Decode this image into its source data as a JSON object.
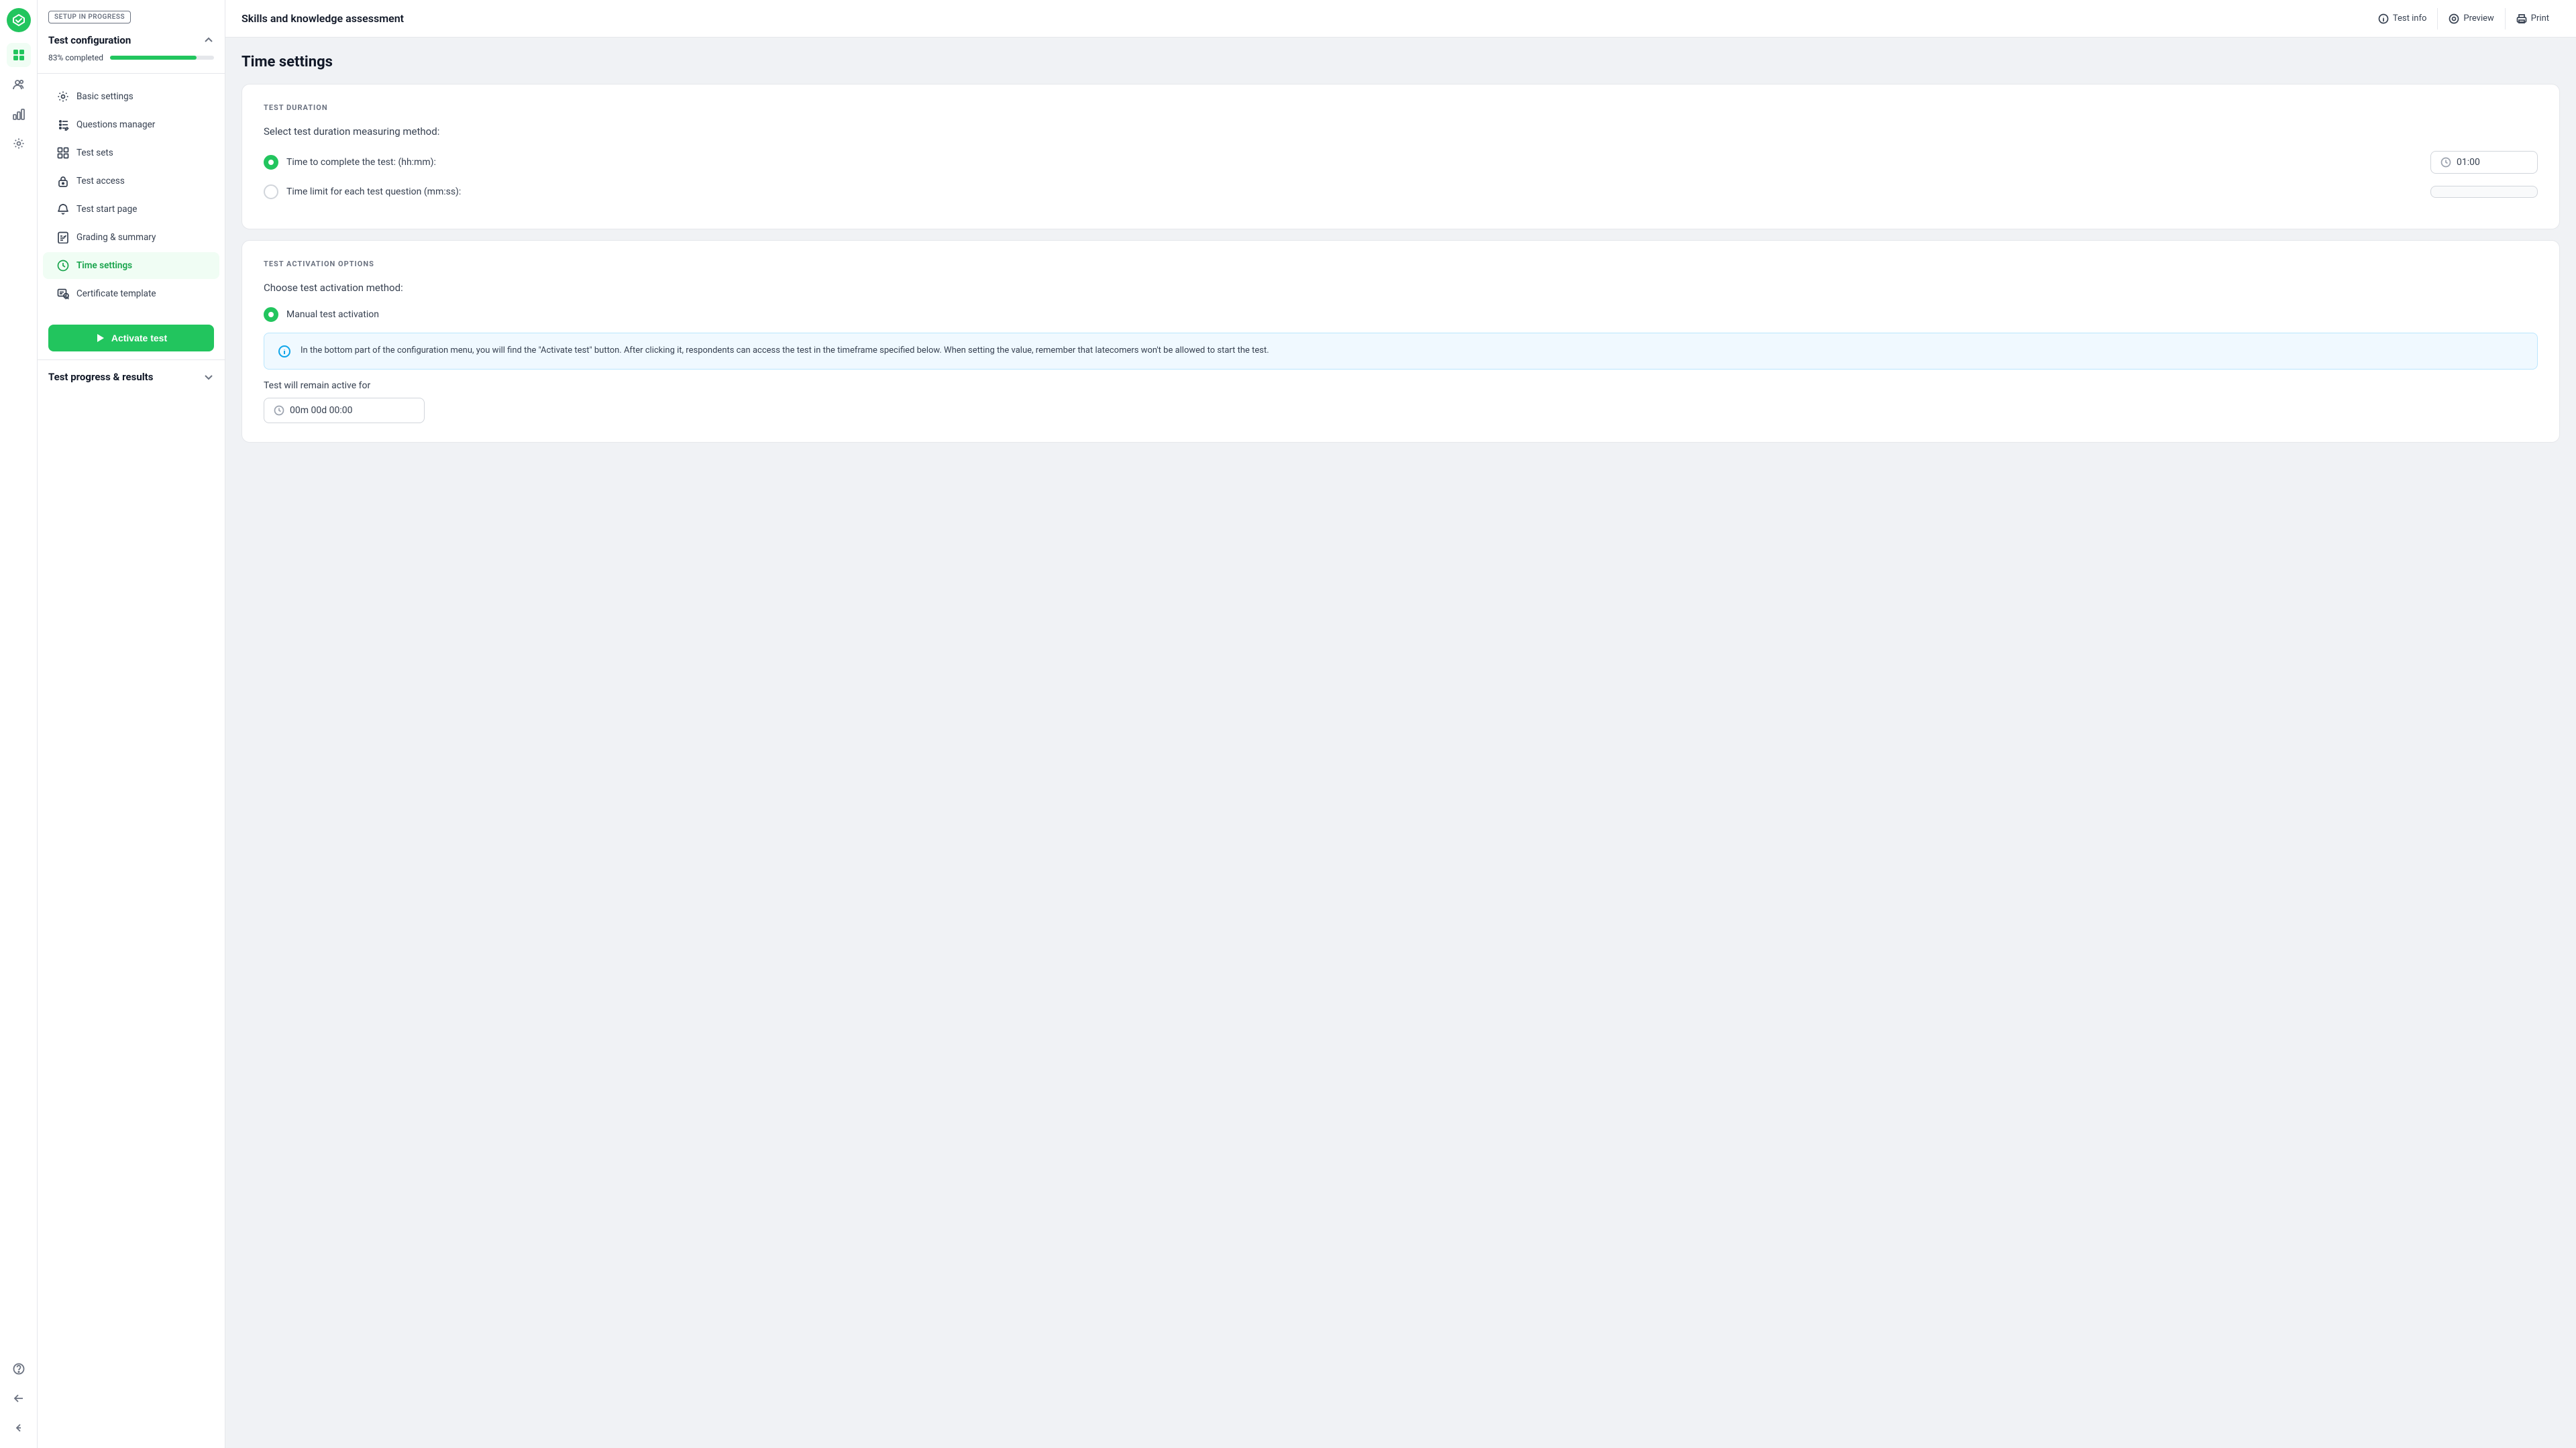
{
  "app": {
    "title": "Skills and knowledge assessment"
  },
  "topbar": {
    "test_info_label": "Test info",
    "preview_label": "Preview",
    "print_label": "Print"
  },
  "sidebar": {
    "setup_badge": "SETUP IN PROGRESS",
    "configuration_title": "Test configuration",
    "progress_label": "83% completed",
    "progress_percent": 83,
    "nav_items": [
      {
        "id": "basic-settings",
        "label": "Basic settings",
        "icon": "gear"
      },
      {
        "id": "questions-manager",
        "label": "Questions manager",
        "icon": "list-edit"
      },
      {
        "id": "test-sets",
        "label": "Test sets",
        "icon": "grid"
      },
      {
        "id": "test-access",
        "label": "Test access",
        "icon": "lock"
      },
      {
        "id": "test-start-page",
        "label": "Test start page",
        "icon": "bell"
      },
      {
        "id": "grading-summary",
        "label": "Grading & summary",
        "icon": "doc-chart"
      },
      {
        "id": "time-settings",
        "label": "Time settings",
        "icon": "clock",
        "active": true
      },
      {
        "id": "certificate-template",
        "label": "Certificate template",
        "icon": "certificate"
      }
    ],
    "activate_btn": "Activate test",
    "progress_results_title": "Test progress & results"
  },
  "main": {
    "page_title": "Time settings",
    "sections": {
      "duration": {
        "label": "TEST DURATION",
        "description": "Select test duration measuring method:",
        "options": [
          {
            "id": "complete-test",
            "label": "Time to complete the test: (hh:mm):",
            "checked": true,
            "value": "01:00"
          },
          {
            "id": "per-question",
            "label": "Time limit for each test question (mm:ss):",
            "checked": false,
            "value": ""
          }
        ]
      },
      "activation": {
        "label": "TEST ACTIVATION OPTIONS",
        "description": "Choose test activation method:",
        "options": [
          {
            "id": "manual",
            "label": "Manual test activation",
            "checked": true
          }
        ],
        "info_text": "In the bottom part of the configuration menu, you will find the \"Activate test\" button. After clicking it, respondents can access the test in the timeframe specified below. When setting the value, remember that latecomers won't be allowed to start the test.",
        "remain_active_label": "Test will remain active for",
        "remain_active_value": "00m 00d 00:00"
      }
    }
  }
}
